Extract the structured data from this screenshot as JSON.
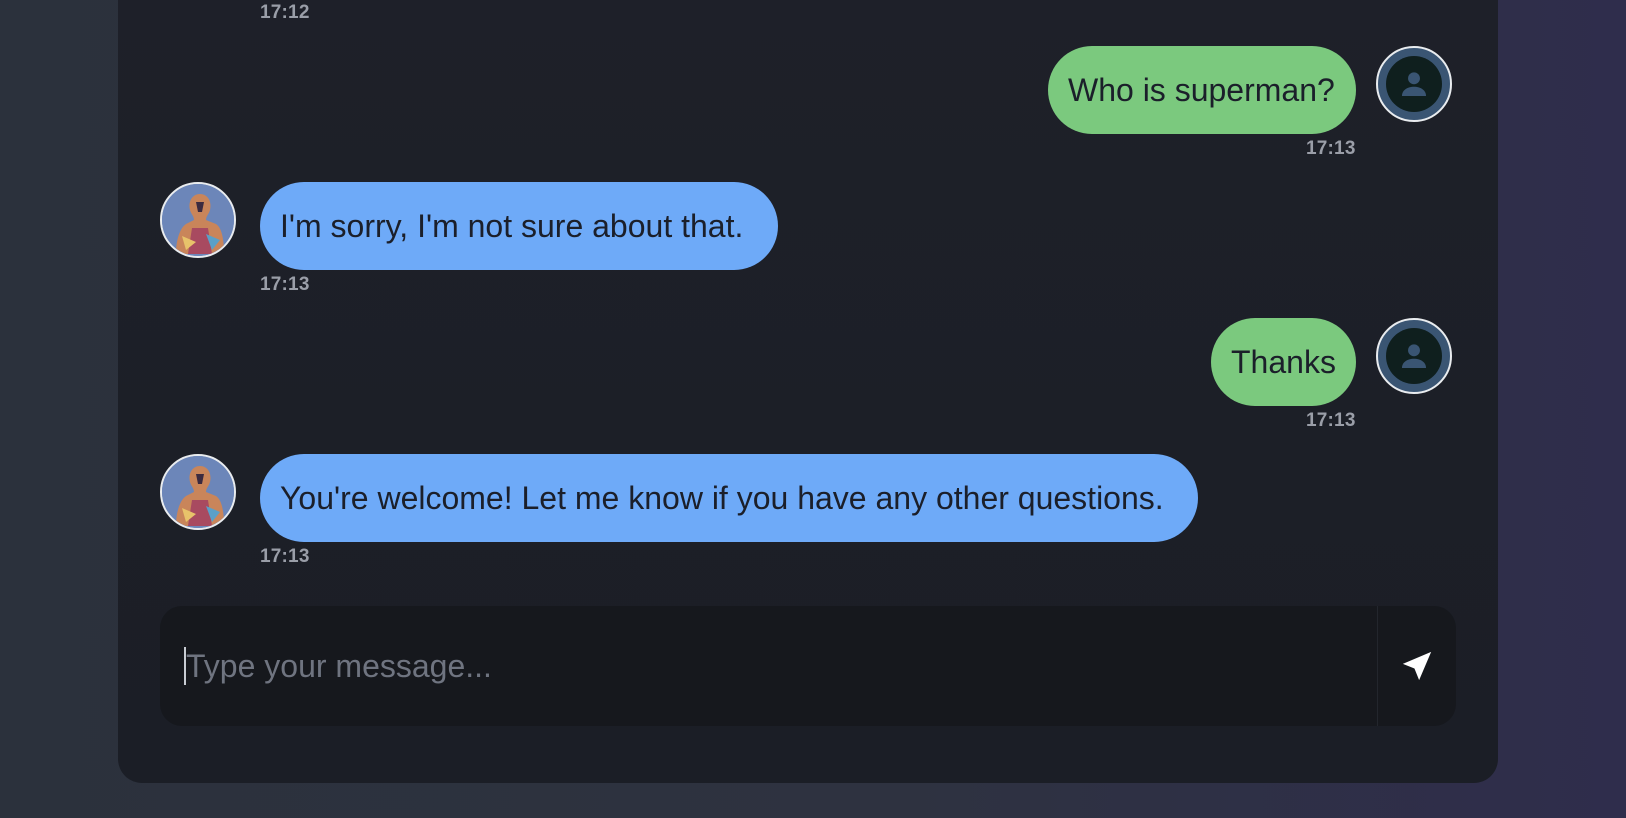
{
  "messages": [
    {
      "id": "m0",
      "sender": "bot",
      "text": "",
      "time": "17:12"
    },
    {
      "id": "m1",
      "sender": "user",
      "text": "Who is superman?",
      "time": "17:13"
    },
    {
      "id": "m2",
      "sender": "bot",
      "text": "I'm sorry, I'm not sure about that.",
      "time": "17:13"
    },
    {
      "id": "m3",
      "sender": "user",
      "text": "Thanks",
      "time": "17:13"
    },
    {
      "id": "m4",
      "sender": "bot",
      "text": "You're welcome! Let me know if you have any other questions.",
      "time": "17:13"
    }
  ],
  "composer": {
    "placeholder": "Type your message...",
    "value": "",
    "send_icon": "send-icon"
  },
  "colors": {
    "user_bubble": "#7bc97e",
    "bot_bubble": "#6eaaf8",
    "panel": "#1e2029",
    "input_bg": "#16181d"
  },
  "icons": {
    "user_avatar": "user-avatar-icon",
    "bot_avatar": "bot-avatar-image"
  }
}
